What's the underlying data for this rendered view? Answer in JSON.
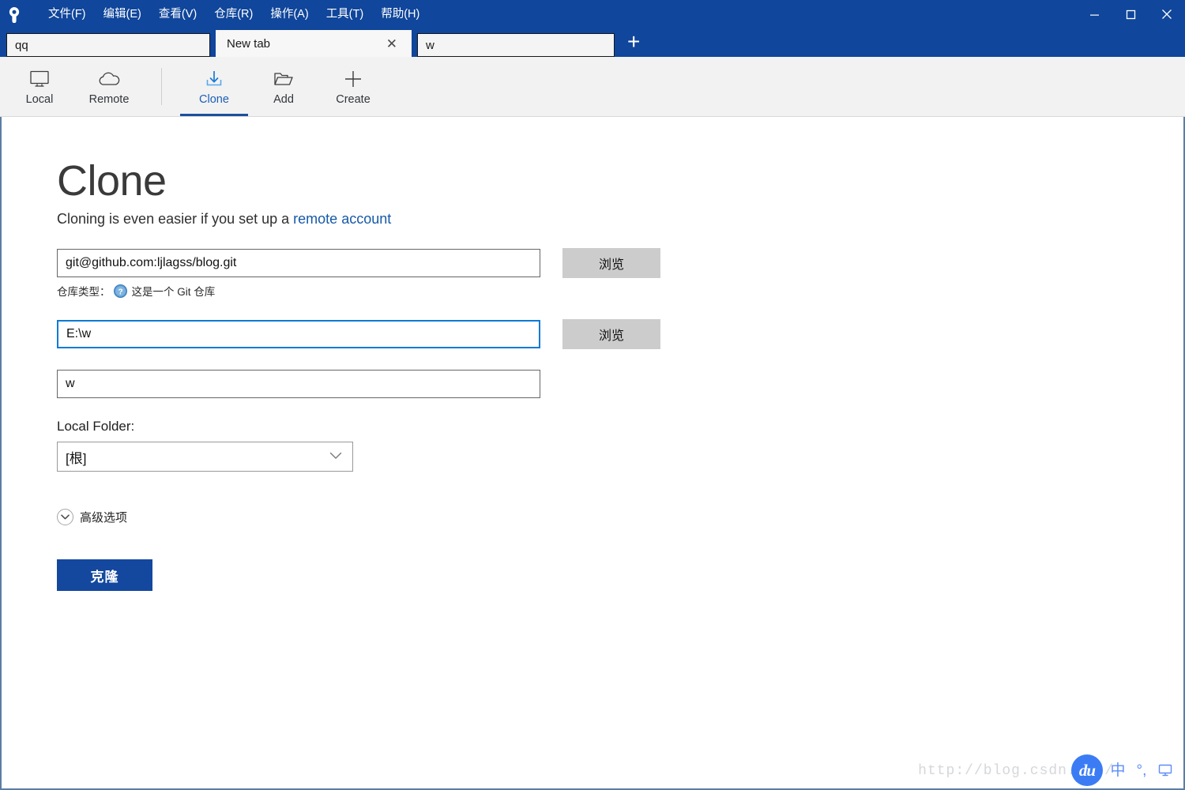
{
  "window": {
    "logo_icon": "sourcetree-logo-icon",
    "menu": [
      {
        "label": "文件(F)",
        "accel": "F"
      },
      {
        "label": "编辑(E)",
        "accel": "E"
      },
      {
        "label": "查看(V)",
        "accel": "V"
      },
      {
        "label": "仓库(R)",
        "accel": "R"
      },
      {
        "label": "操作(A)",
        "accel": "A"
      },
      {
        "label": "工具(T)",
        "accel": "T"
      },
      {
        "label": "帮助(H)",
        "accel": "H"
      }
    ],
    "controls": {
      "minimize": "—",
      "maximize": "□",
      "close": "✕"
    },
    "titlebar_color": "#10469b"
  },
  "tabs": {
    "items": [
      {
        "label": "qq",
        "active": false,
        "closable": false
      },
      {
        "label": "New tab",
        "active": true,
        "closable": true
      },
      {
        "label": "w",
        "active": false,
        "closable": false
      }
    ],
    "close_glyph": "✕",
    "add_label": "+"
  },
  "toolbar": {
    "items": [
      {
        "label": "Local",
        "icon": "monitor-icon",
        "active": false
      },
      {
        "label": "Remote",
        "icon": "cloud-icon",
        "active": false
      },
      {
        "label": "Clone",
        "icon": "download-clone-icon",
        "active": true
      },
      {
        "label": "Add",
        "icon": "folder-open-icon",
        "active": false
      },
      {
        "label": "Create",
        "icon": "plus-icon",
        "active": false
      }
    ],
    "accent_color": "#1c5fb4"
  },
  "main": {
    "title": "Clone",
    "subtitle_prefix": "Cloning is even easier if you set up a ",
    "subtitle_link": "remote account",
    "source_url": {
      "value": "git@github.com:ljlagss/blog.git",
      "placeholder": "",
      "browse_label": "浏览"
    },
    "repo_type": {
      "label": "仓库类型：",
      "icon": "question-circle-icon",
      "status": "这是一个 Git 仓库"
    },
    "destination_path": {
      "value": "E:\\w",
      "placeholder": "",
      "browse_label": "浏览",
      "focused": true
    },
    "repo_name": {
      "value": "w",
      "placeholder": ""
    },
    "local_folder": {
      "label": "Local Folder:",
      "selected": "[根]",
      "options": [
        "[根]"
      ],
      "chevron_icon": "chevron-down-icon"
    },
    "advanced": {
      "label": "高级选项",
      "icon": "chevron-down-circle-icon"
    },
    "clone_button": {
      "label": "克隆",
      "color": "#14489e"
    }
  },
  "overlay": {
    "watermark": "http://blog.csdn.net/",
    "ime": {
      "logo_text": "du",
      "logo_color": "#3b7cf5",
      "mode": "中",
      "punctuation": "°,",
      "keyboard_icon": "keyboard-icon"
    }
  }
}
